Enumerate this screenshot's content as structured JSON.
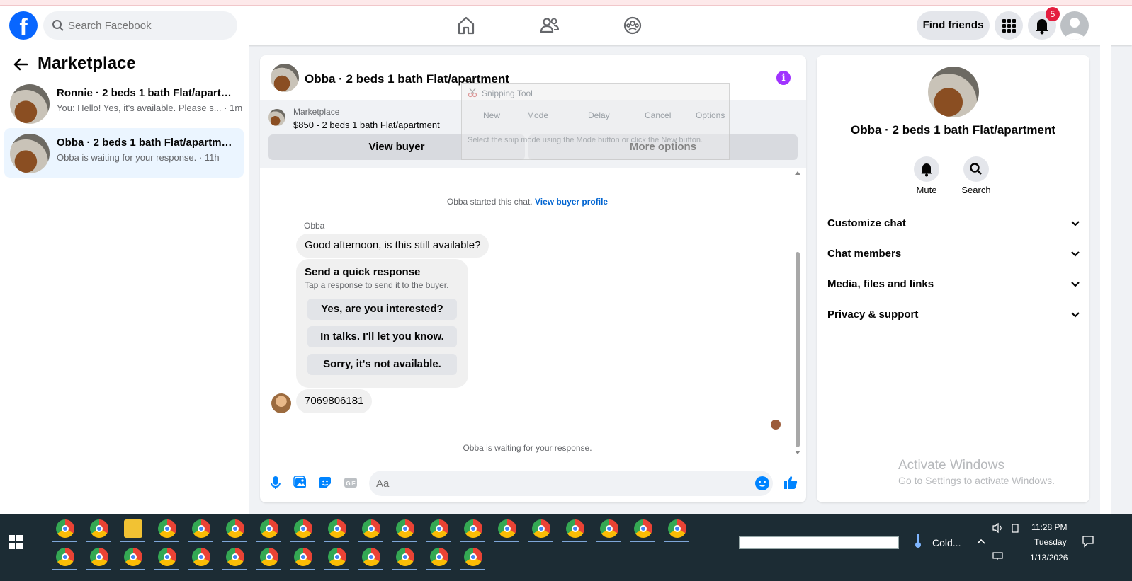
{
  "header": {
    "search_placeholder": "Search Facebook",
    "find_friends": "Find friends",
    "notification_count": "5"
  },
  "sidebar": {
    "title": "Marketplace",
    "conversations": [
      {
        "title": "Ronnie · 2 beds 1 bath Flat/apartm...",
        "snippet": "You: Hello! Yes, it's available. Please s... · 1m",
        "active": false
      },
      {
        "title": "Obba · 2 beds 1 bath Flat/apartment",
        "snippet": "Obba is waiting for your response. · 11h",
        "active": true
      }
    ]
  },
  "chat": {
    "title": "Obba · 2 beds 1 bath Flat/apartment",
    "listing_source": "Marketplace",
    "listing_price": "$850 - 2 beds 1 bath Flat/apartment",
    "view_buyer": "View buyer",
    "more_options": "More options",
    "started_text": "Obba started this chat.",
    "view_buyer_profile": "View buyer profile",
    "sender_name": "Obba",
    "message1": "Good afternoon, is this still available?",
    "quick_title": "Send a quick response",
    "quick_sub": "Tap a response to send it to the buyer.",
    "quick_replies": [
      "Yes, are you interested?",
      "In talks. I'll let you know.",
      "Sorry, it's not available."
    ],
    "message2": "7069806181",
    "waiting": "Obba is waiting for your response.",
    "composer_placeholder": "Aa"
  },
  "snipping": {
    "title": "Snipping Tool",
    "new": "New",
    "mode": "Mode",
    "delay": "Delay",
    "cancel": "Cancel",
    "options": "Options",
    "desc": "Select the snip mode using the Mode button or click the New button."
  },
  "info_panel": {
    "title": "Obba · 2 beds 1 bath Flat/apartment",
    "mute": "Mute",
    "search": "Search",
    "rows": [
      "Customize chat",
      "Chat members",
      "Media, files and links",
      "Privacy & support"
    ]
  },
  "watermark": {
    "line1": "Activate Windows",
    "line2": "Go to Settings to activate Windows."
  },
  "taskbar": {
    "weather": "Cold...",
    "time": "11:28 PM",
    "day": "Tuesday",
    "date": "1/13/2026"
  },
  "colors": {
    "brand": "#0866ff",
    "messenger_accent": "#0084ff",
    "info_purple": "#a033ff"
  }
}
